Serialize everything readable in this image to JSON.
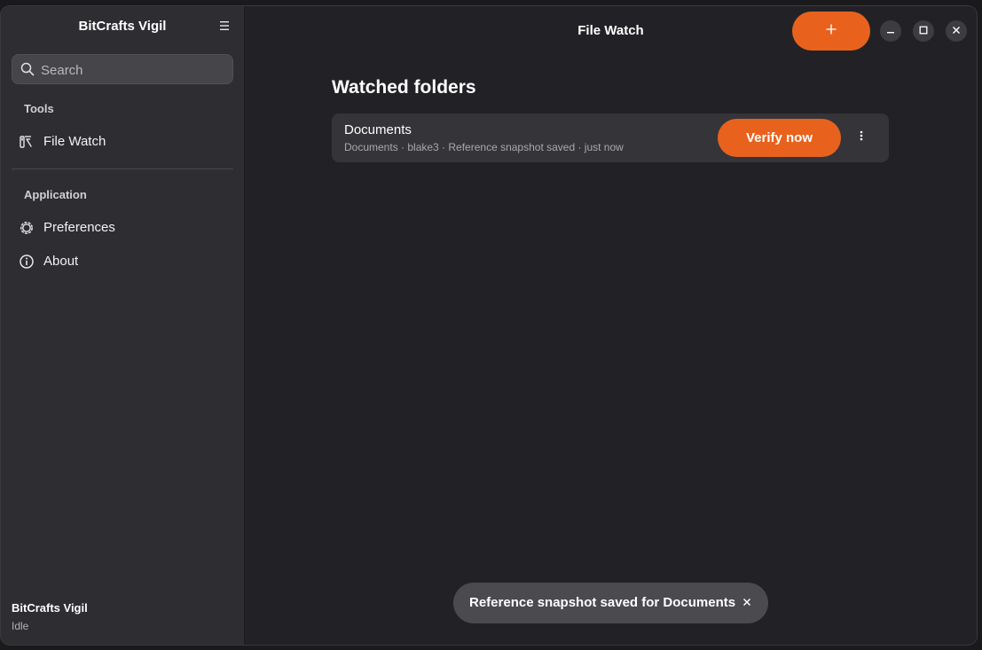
{
  "app": {
    "name": "BitCrafts Vigil"
  },
  "sidebar": {
    "title": "BitCrafts Vigil",
    "menu_icon": "hamburger-menu-icon",
    "search": {
      "placeholder": "Search",
      "value": ""
    },
    "sections": [
      {
        "label": "Tools",
        "items": [
          {
            "label": "File Watch",
            "icon": "file-watch-icon"
          }
        ]
      },
      {
        "label": "Application",
        "items": [
          {
            "label": "Preferences",
            "icon": "gear-icon"
          },
          {
            "label": "About",
            "icon": "info-icon"
          }
        ]
      }
    ],
    "footer": {
      "title": "BitCrafts Vigil",
      "status": "Idle"
    }
  },
  "header": {
    "title": "File Watch",
    "add_icon": "plus-icon",
    "window_controls": [
      "minimize-icon",
      "maximize-icon",
      "close-icon"
    ]
  },
  "main": {
    "heading": "Watched folders",
    "folders": [
      {
        "name": "Documents",
        "meta": "Documents · blake3 · Reference snapshot saved · just now",
        "action_label": "Verify now"
      }
    ]
  },
  "toast": {
    "message": "Reference snapshot saved for Documents"
  },
  "colors": {
    "accent": "#e8621d",
    "sidebar_bg": "#2e2e32",
    "content_bg": "#222226",
    "card_bg": "#353539",
    "toast_bg": "#4a4a4f"
  }
}
